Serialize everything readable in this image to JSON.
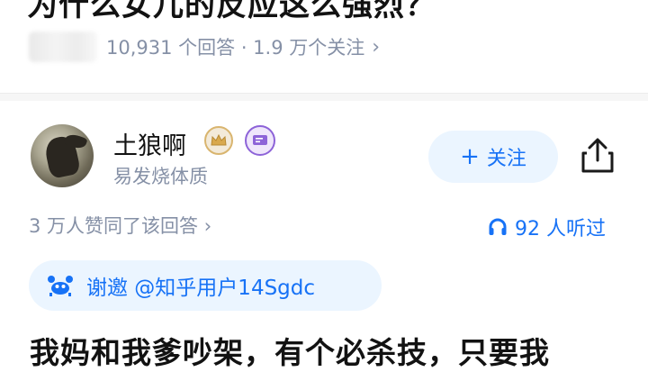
{
  "question": {
    "title": "为什么女儿的反应这么强烈？",
    "stats": "10,931 个回答 · 1.9 万个关注",
    "chevron_icon": "chevron-right-icon"
  },
  "author": {
    "name": "土狼啊",
    "bio": "易发烧体质",
    "avatar_icon": "avatar",
    "badges": [
      "crown-badge-icon",
      "creator-badge-icon"
    ]
  },
  "actions": {
    "follow_label": "关注",
    "follow_plus": "+",
    "share_icon": "share-icon"
  },
  "engagement": {
    "upvote_text": "3 万人赞同了该回答 ›",
    "listen_text": "92 人听过",
    "listen_icon": "headphones-icon",
    "accent": "#1772f6"
  },
  "invite": {
    "text": "谢邀 @知乎用户14Sgdc",
    "icon": "invite-crab-icon"
  },
  "answer": {
    "first_line": "我妈和我爹吵架，有个必杀技，只要我"
  }
}
